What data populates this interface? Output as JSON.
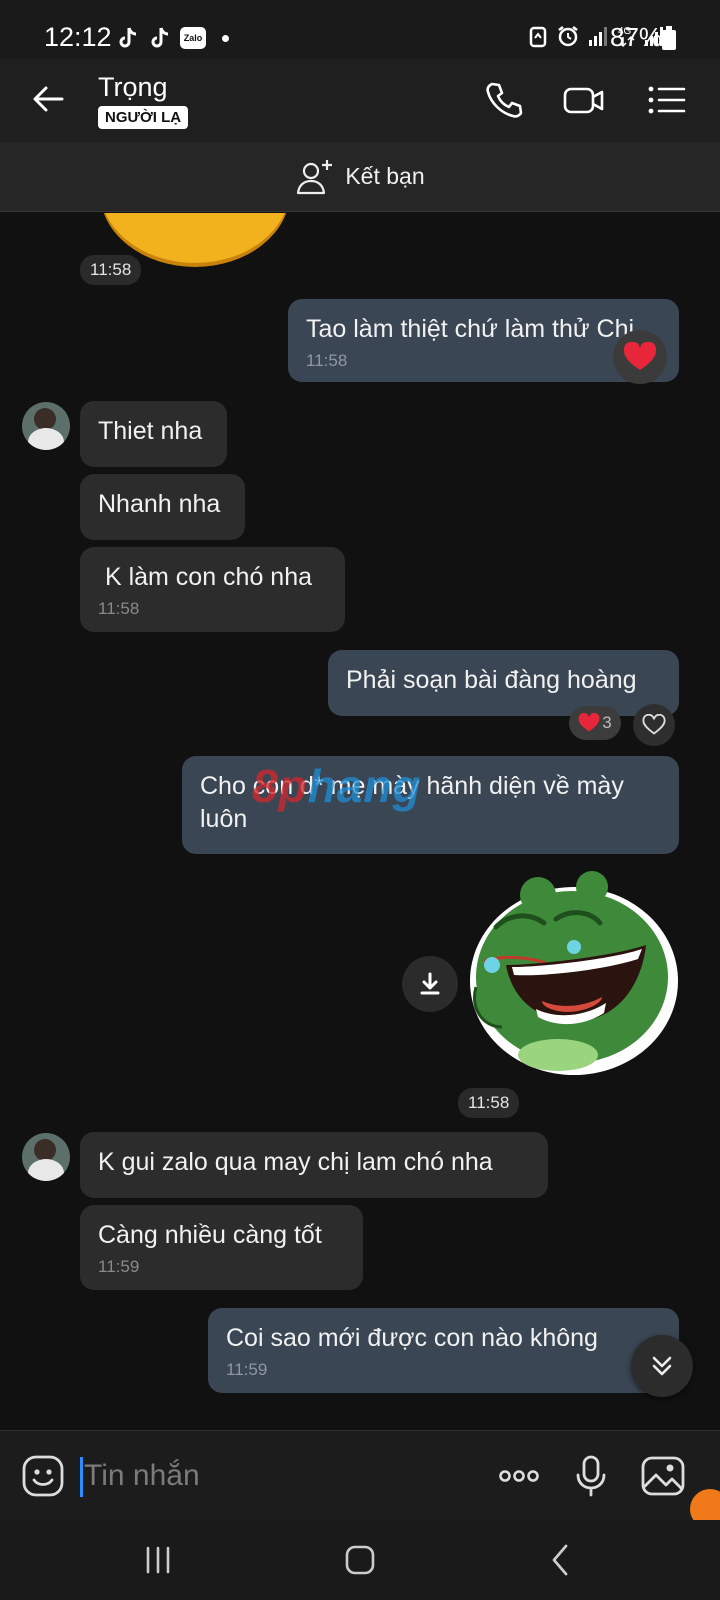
{
  "status_bar": {
    "time": "12:12",
    "battery": "87%",
    "zalo_label": "Zalo"
  },
  "header": {
    "contact_name": "Trọng",
    "stranger_badge": "NGƯỜI LẠ"
  },
  "add_friend": {
    "label": "Kết bạn"
  },
  "messages": [
    {
      "side": "time",
      "time": "11:58"
    },
    {
      "side": "out",
      "text": "Tao làm thiệt chứ làm thử Chi",
      "time": "11:58",
      "reaction": "heart"
    },
    {
      "side": "in",
      "text": "Thiet nha"
    },
    {
      "side": "in",
      "text": "Nhanh nha"
    },
    {
      "side": "in",
      "text": " K làm con chó nha",
      "time": "11:58"
    },
    {
      "side": "out",
      "text": "Phải soạn bài đàng hoàng",
      "reaction_count": "3"
    },
    {
      "side": "out",
      "text": "Cho con d* mẹ mày hãnh diện về mày luôn"
    },
    {
      "side": "sticker",
      "time": "11:58"
    },
    {
      "side": "in",
      "text": "K gui zalo qua may chị lam chó nha"
    },
    {
      "side": "in",
      "text": "Càng nhiều càng tốt",
      "time": "11:59"
    },
    {
      "side": "out",
      "text": "Coi sao mới được con nào không",
      "time": "11:59"
    }
  ],
  "watermark": {
    "part_a": "8p",
    "part_b": "hang"
  },
  "input": {
    "placeholder": "Tin nhắn"
  },
  "colors": {
    "outgoing_bubble": "#3a4654",
    "incoming_bubble": "#2c2c2c",
    "background": "#111111",
    "accent": "#2d8cff"
  }
}
